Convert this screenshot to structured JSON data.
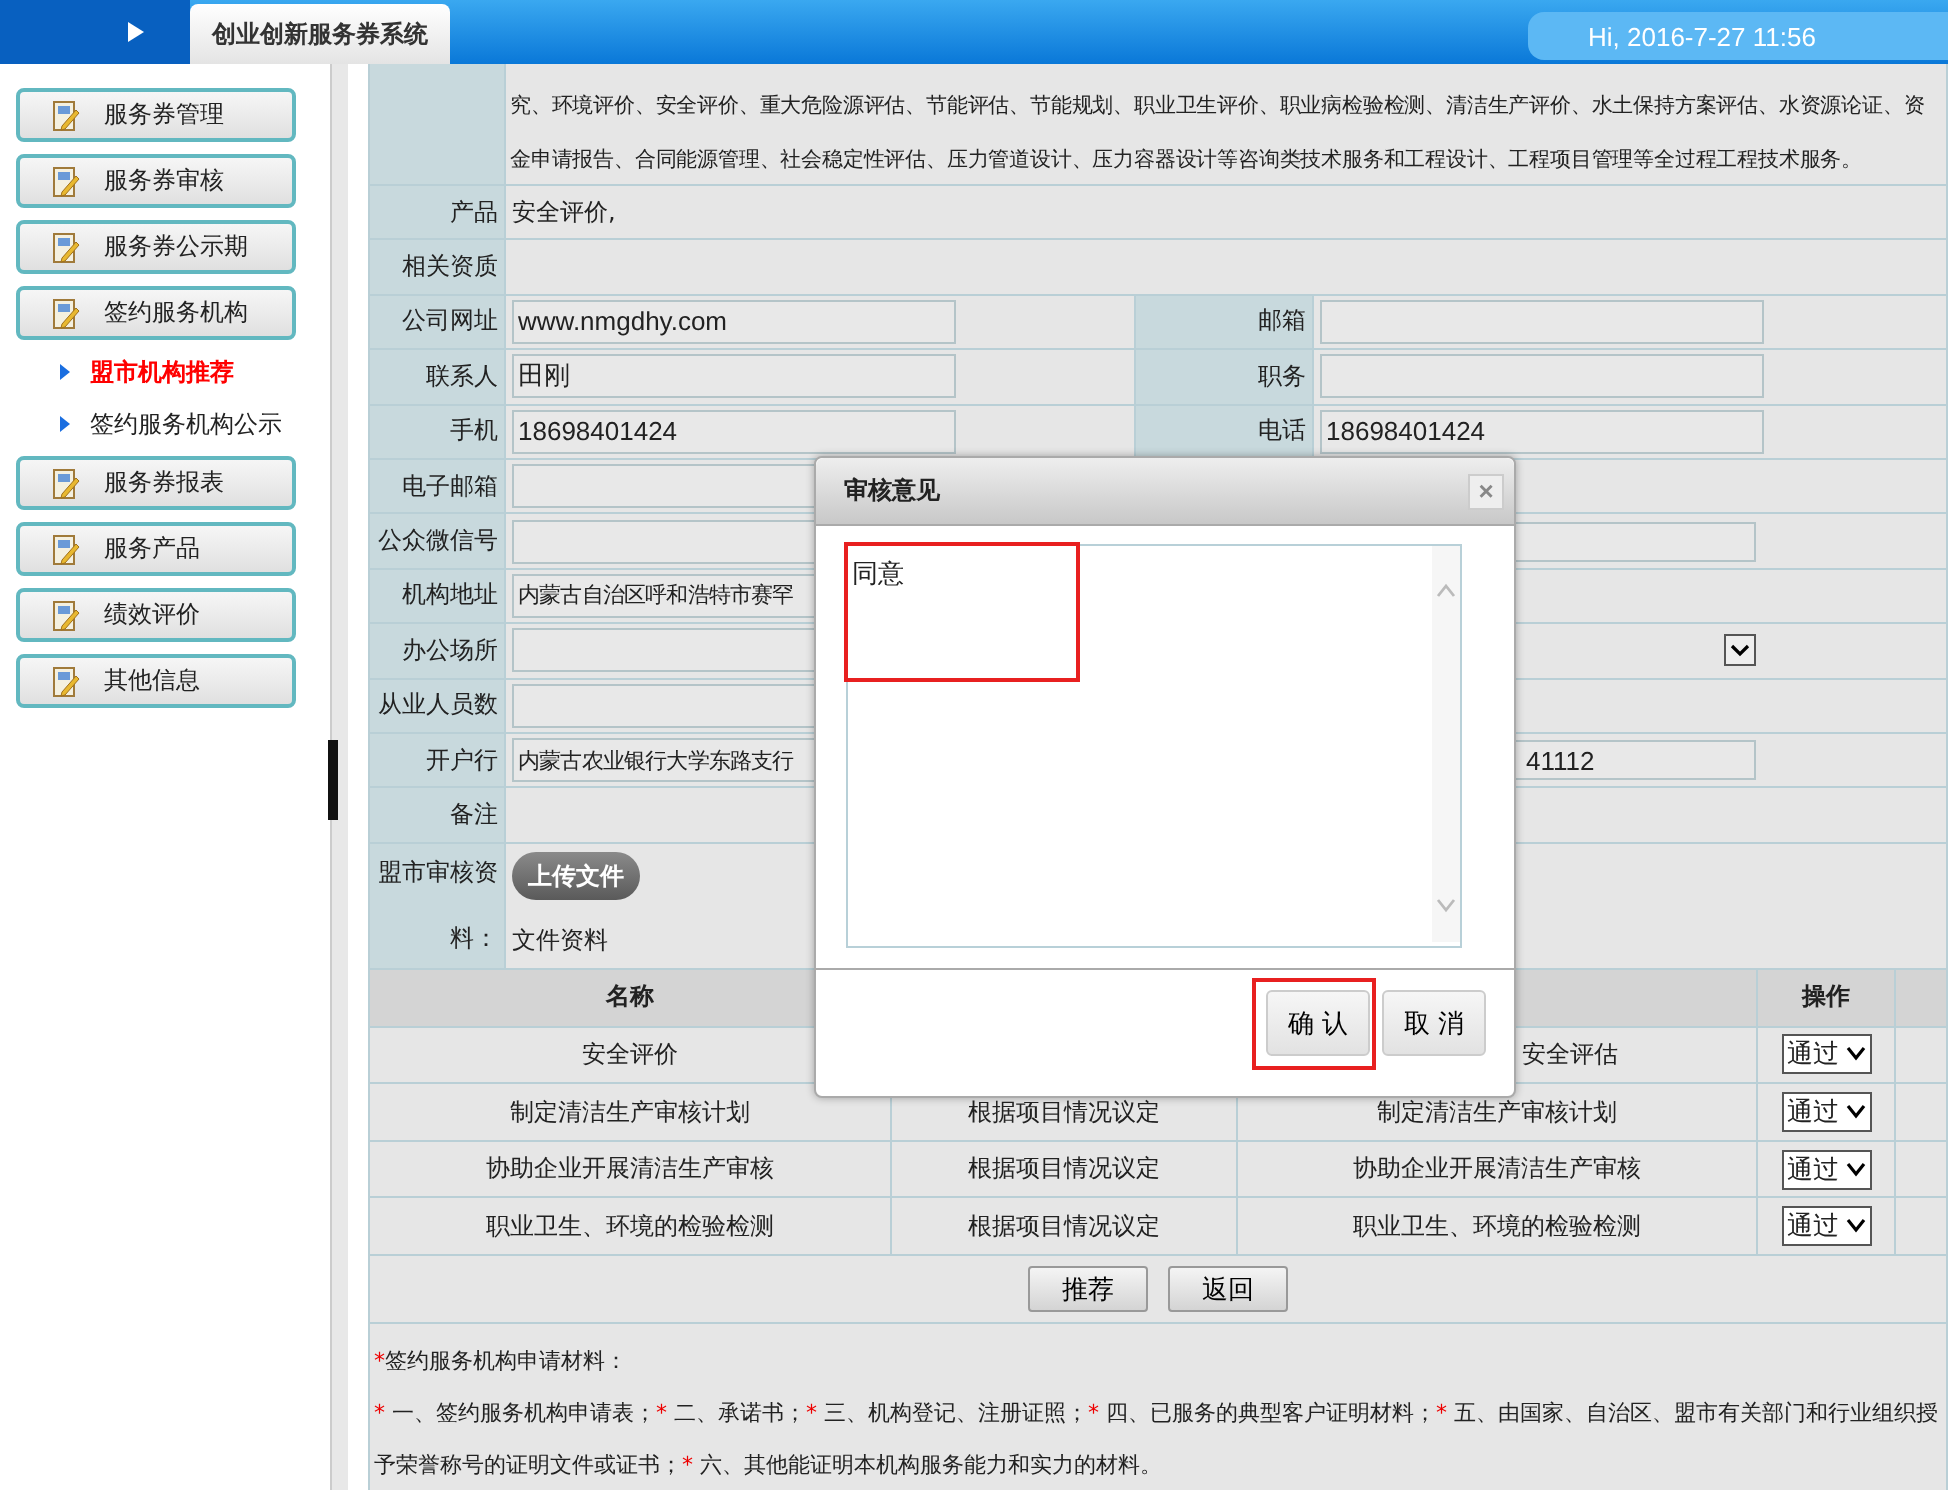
{
  "header": {
    "system_title": "创业创新服务券系统",
    "greeting": "Hi, 2016-7-27 11:56"
  },
  "sidebar": {
    "items": [
      {
        "label": "服务券管理",
        "kind": "group"
      },
      {
        "label": "服务券审核",
        "kind": "group"
      },
      {
        "label": "服务券公示期",
        "kind": "group"
      },
      {
        "label": "签约服务机构",
        "kind": "group"
      },
      {
        "label": "盟市机构推荐",
        "kind": "sub",
        "selected": true
      },
      {
        "label": "签约服务机构公示",
        "kind": "sub",
        "selected": false
      },
      {
        "label": "服务券报表",
        "kind": "group"
      },
      {
        "label": "服务产品",
        "kind": "group"
      },
      {
        "label": "绩效评价",
        "kind": "group"
      },
      {
        "label": "其他信息",
        "kind": "group"
      }
    ]
  },
  "form": {
    "scope_lines": [
      "究、环境评价、安全评价、重大危险源评估、节能评估、节能规划、职业卫生评价、职业病检验检测、清洁生产评价、水土保持方案评估、水资源论证、资",
      "金申请报告、合同能源管理、社会稳定性评估、压力管道设计、压力容器设计等咨询类技术服务和工程设计、工程项目管理等全过程工程技术服务。"
    ],
    "rows": [
      {
        "kind": "text",
        "label": "产品",
        "value": "安全评价,"
      },
      {
        "kind": "text",
        "label": "相关资质"
      },
      {
        "kind": "pair",
        "label": "公司网址",
        "value": "www.nmgdhy.com",
        "right": {
          "kind": "input",
          "label": "邮箱"
        }
      },
      {
        "kind": "pair",
        "label": "联系人",
        "value": "田刚",
        "right": {
          "kind": "input",
          "label": "职务"
        }
      },
      {
        "kind": "pair",
        "label": "手机",
        "value": "18698401424",
        "right": {
          "kind": "input",
          "label": "电话",
          "value": "18698401424"
        }
      },
      {
        "kind": "pair",
        "label": "电子邮箱",
        "right": {
          "kind": "none"
        }
      },
      {
        "kind": "pair",
        "label": "公众微信号",
        "right": {
          "kind": "input"
        }
      },
      {
        "kind": "pair",
        "label": "机构地址",
        "value": "内蒙古自治区呼和浩特市赛罕",
        "right": {
          "kind": "none"
        }
      },
      {
        "kind": "pair",
        "label": "办公场所",
        "right": {
          "kind": "select"
        }
      },
      {
        "kind": "pair",
        "label": "从业人员数",
        "right": {
          "kind": "none"
        }
      },
      {
        "kind": "pair",
        "label": "开户行",
        "value": "内蒙古农业银行大学东路支行",
        "right": {
          "kind": "input",
          "value": "41112"
        }
      },
      {
        "kind": "text",
        "label": "备注"
      },
      {
        "kind": "upload",
        "label": "盟市审核资",
        "label_tail": "料：",
        "button": "上传文件",
        "value": "文件资料"
      }
    ]
  },
  "services": {
    "header": {
      "name": "名称",
      "action": "操作"
    },
    "rows": [
      {
        "name": "安全评价",
        "result": "安全评估",
        "status": "通过"
      },
      {
        "name": "制定清洁生产审核计划",
        "basis": "根据项目情况议定",
        "result": "制定清洁生产审核计划",
        "status": "通过"
      },
      {
        "name": "协助企业开展清洁生产审核",
        "basis": "根据项目情况议定",
        "result": "协助企业开展清洁生产审核",
        "status": "通过"
      },
      {
        "name": "职业卫生、环境的检验检测",
        "basis": "根据项目情况议定",
        "result": "职业卫生、环境的检验检测",
        "status": "通过"
      }
    ],
    "buttons": [
      "推荐",
      "返回"
    ]
  },
  "notes": {
    "title": {
      "mark": "*",
      "text": "签约服务机构申请材料："
    },
    "items": [
      {
        "mark": "*",
        "text": "一、签约服务机构申请表；"
      },
      {
        "mark": "*",
        "text": "二、承诺书；"
      },
      {
        "mark": "*",
        "text": "三、机构登记、注册证照；"
      },
      {
        "mark": "*",
        "text": "四、已服务的典型客户证明材料；"
      },
      {
        "mark": "*",
        "text": "五、由国家、自治区、盟市有关部门和行业组织授予荣誉称号的证明文件或证书；"
      },
      {
        "mark": "*",
        "text": "六、其他能证明本机构服务能力和实力的材料。"
      }
    ]
  },
  "dialog": {
    "title": "审核意见",
    "close": "×",
    "opinion": "同意",
    "confirm": "确 认",
    "cancel": "取 消"
  }
}
